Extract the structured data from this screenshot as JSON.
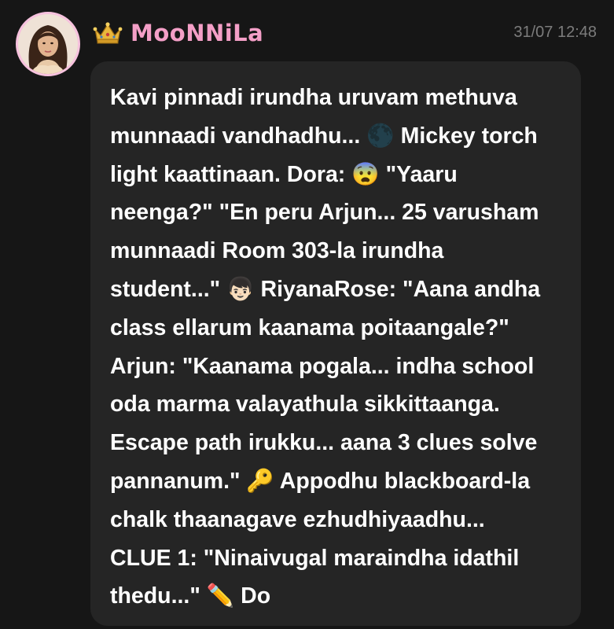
{
  "message": {
    "author": "MooNNiLa",
    "crown_icon": "crown-icon",
    "timestamp": "31/07 12:48",
    "body": "Kavi pinnadi irundha uruvam methuva\nmunnaadi vandhadhu... 🌑 Mickey torch\nlight kaattinaan. Dora: 😨 \"Yaaru\nneenga?\" \"En peru Arjun... 25 varusham\nmunnaadi Room 303-la irundha\nstudent...\" 👦🏻 RiyanaRose: \"Aana andha\nclass ellarum kaanama poitaangale?\"\nArjun: \"Kaanama pogala... indha school\noda marma valayathula sikkittaanga.\nEscape path irukku... aana 3 clues solve\npannanum.\" 🔑 Appodhu blackboard-la\nchalk thaanagave ezhudhiyaadhu...\nCLUE 1: \"Ninaivugal maraindha idathil\nthedu...\" ✏️ Do"
  },
  "colors": {
    "background": "#161616",
    "bubble": "#252525",
    "username": "#f49fc7",
    "timestamp": "#7c7c7c",
    "text": "#ffffff"
  }
}
